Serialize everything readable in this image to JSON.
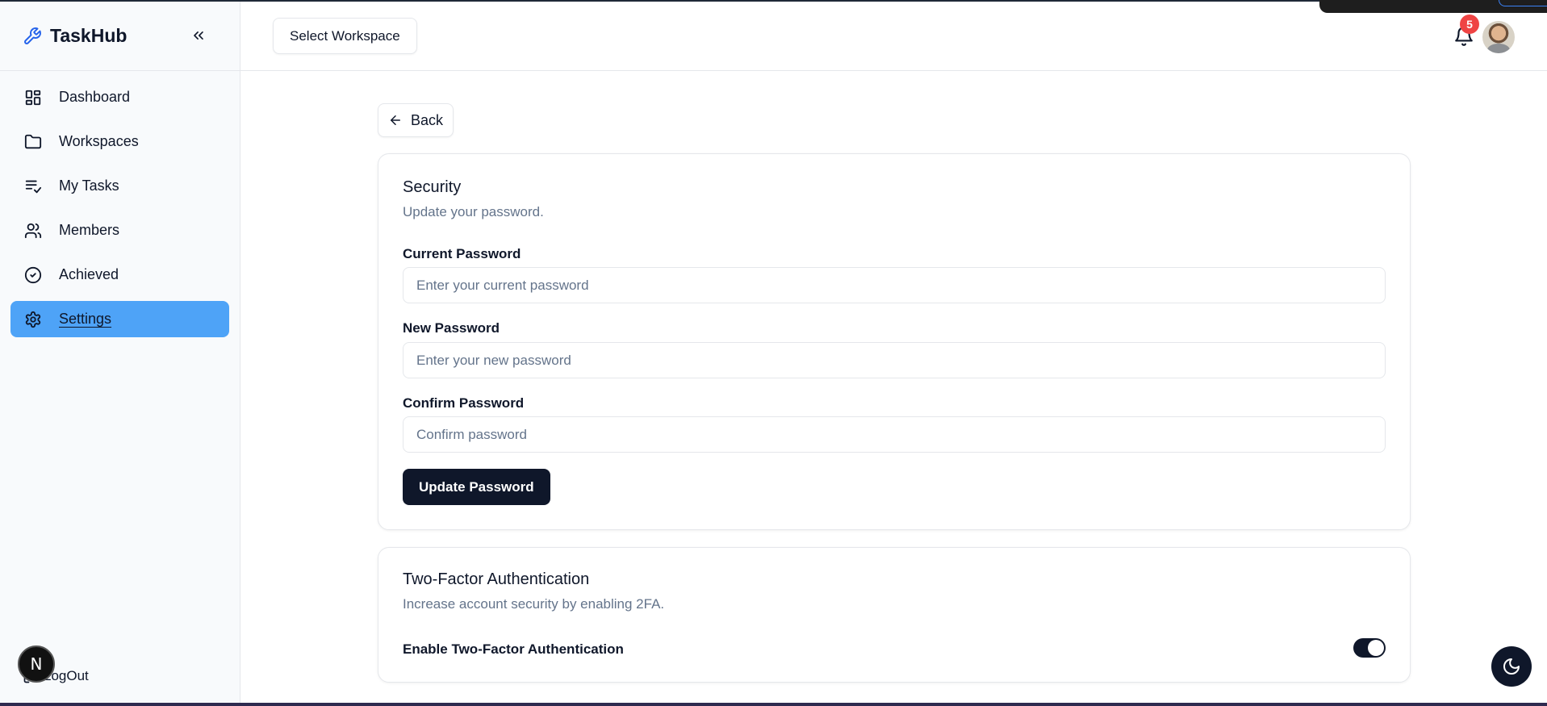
{
  "app": {
    "name": "TaskHub"
  },
  "sidebar": {
    "items": [
      {
        "label": "Dashboard",
        "icon": "dashboard-icon"
      },
      {
        "label": "Workspaces",
        "icon": "folder-icon"
      },
      {
        "label": "My Tasks",
        "icon": "list-check-icon"
      },
      {
        "label": "Members",
        "icon": "users-icon"
      },
      {
        "label": "Achieved",
        "icon": "check-circle-icon"
      },
      {
        "label": "Settings",
        "icon": "gear-icon",
        "active": true
      }
    ],
    "logout_label": "LogOut",
    "next_badge": "N"
  },
  "header": {
    "workspace_button": "Select Workspace",
    "notification_count": "5"
  },
  "main": {
    "back_label": "Back",
    "security": {
      "title": "Security",
      "description": "Update your password.",
      "current_label": "Current Password",
      "current_placeholder": "Enter your current password",
      "new_label": "New Password",
      "new_placeholder": "Enter your new password",
      "confirm_label": "Confirm Password",
      "confirm_placeholder": "Confirm password",
      "submit_label": "Update Password"
    },
    "two_factor": {
      "title": "Two-Factor Authentication",
      "description": "Increase account security by enabling 2FA.",
      "toggle_label": "Enable Two-Factor Authentication",
      "enabled": true
    }
  },
  "colors": {
    "accent": "#4ea3f7",
    "primary": "#0f172a",
    "brand_icon": "#2563eb",
    "badge": "#ef4444"
  }
}
